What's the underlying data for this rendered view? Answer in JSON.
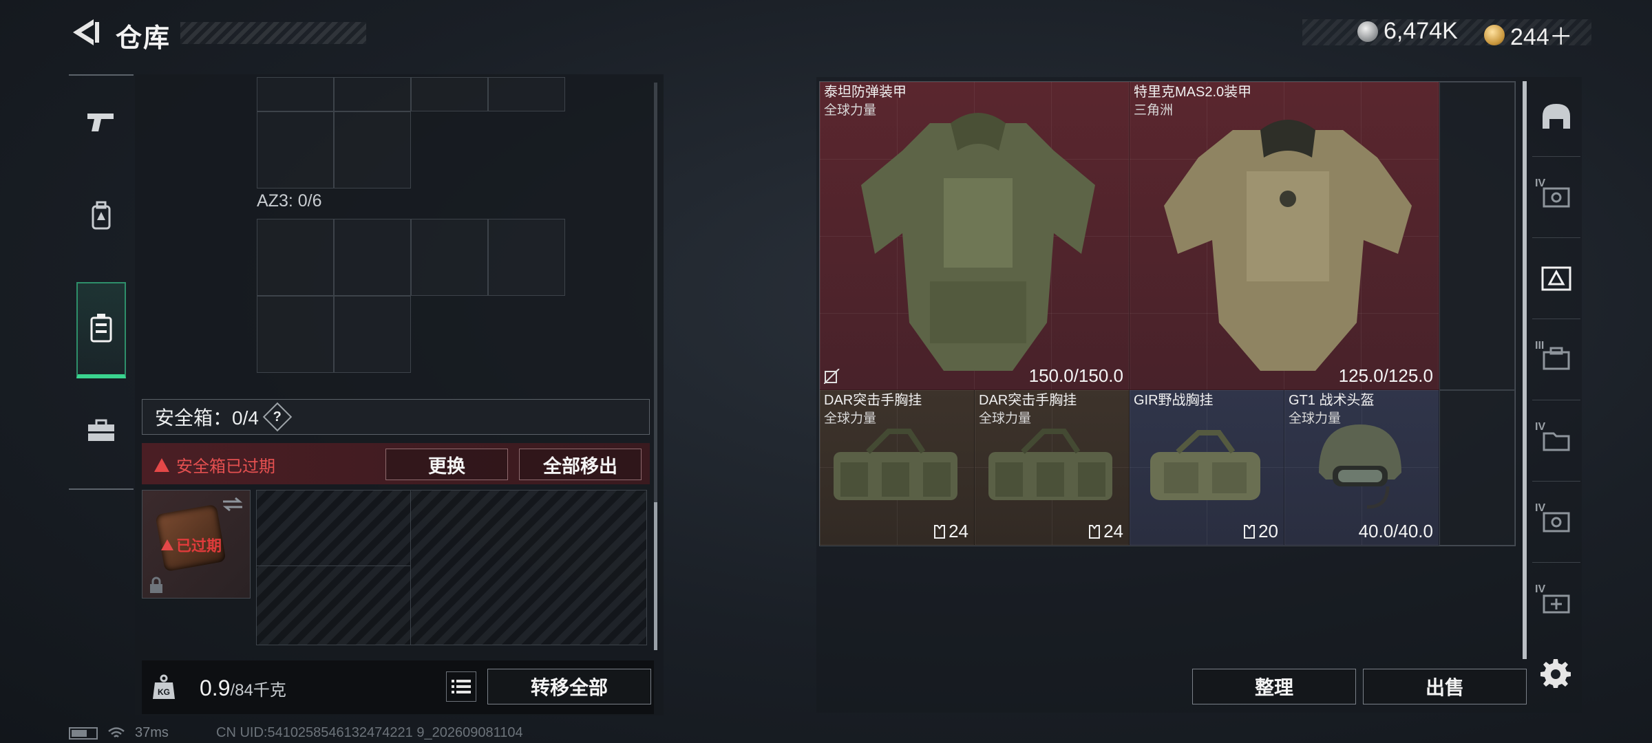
{
  "header": {
    "title": "仓库",
    "currencies": [
      {
        "icon": "silver-coin-icon",
        "value": "6,474K"
      },
      {
        "icon": "gold-coin-icon",
        "value": "244＋"
      }
    ]
  },
  "left_rail": {
    "items": [
      {
        "icon": "pistol-icon",
        "active": false
      },
      {
        "icon": "backpack-icon",
        "active": false
      },
      {
        "icon": "armor-vest-icon",
        "active": true
      },
      {
        "icon": "toolbox-icon",
        "active": false
      }
    ]
  },
  "container": {
    "az3_label": "AZ3: 0/6",
    "safe_box_label": "安全箱：0/4",
    "help_symbol": "?",
    "expired_message": "安全箱已过期",
    "replace_label": "更换",
    "remove_all_label": "全部移出",
    "expired_badge": "已过期"
  },
  "footer": {
    "weight_value": "0.9",
    "weight_capacity": "/84千克",
    "transfer_all_label": "转移全部",
    "sort_label": "整理",
    "sell_label": "出售"
  },
  "items": [
    {
      "name": "泰坦防弹装甲",
      "sub": "全球力量",
      "value": "150.0/150.0",
      "color": "#5a262e"
    },
    {
      "name": "特里克MAS2.0装甲",
      "sub": "三角洲",
      "value": "125.0/125.0",
      "color": "#5a262e"
    },
    {
      "name": "DAR突击手胸挂",
      "sub": "全球力量",
      "value": "24",
      "color": "#3d332b"
    },
    {
      "name": "DAR突击手胸挂",
      "sub": "全球力量",
      "value": "24",
      "color": "#3d332b"
    },
    {
      "name": "GIR野战胸挂",
      "sub": "",
      "value": "20",
      "color": "#30354a"
    },
    {
      "name": "GT1 战术头盔",
      "sub": "全球力量",
      "value": "40.0/40.0",
      "color": "#30354a"
    }
  ],
  "right_rail": {
    "tiers": [
      "IV",
      "IV",
      "III",
      "IV",
      "IV",
      "IV"
    ]
  },
  "status": {
    "ping": "37ms",
    "uid": "CN UID:5410258546132474221 9_202609081104"
  }
}
